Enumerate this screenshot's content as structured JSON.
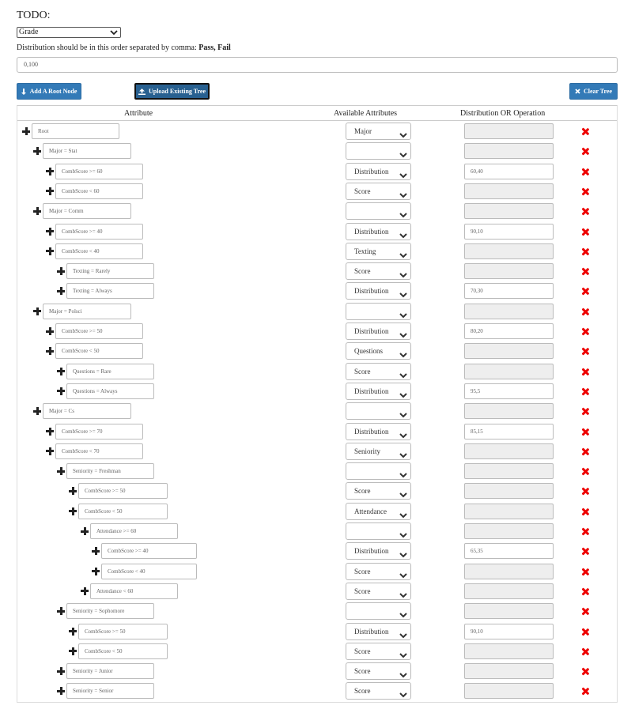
{
  "header": {
    "title": "TODO:",
    "target_value": "Grade",
    "hint_prefix": "Distribution should be in this order separated by comma:",
    "hint_classes": "Pass, Fail",
    "distribution_value": "0,100"
  },
  "buttons": {
    "add_root": "Add A Root Node",
    "upload": "Upload Existing Tree",
    "clear": "Clear Tree"
  },
  "table": {
    "headers": [
      "Attribute",
      "Available Attributes",
      "Distribution OR Operation"
    ],
    "rows": [
      {
        "label": "Root",
        "attribute": "Major",
        "distribution": ""
      },
      {
        "label": "Major = Stat",
        "attribute": "",
        "distribution": ""
      },
      {
        "label": "CombScore >= 60",
        "attribute": "Distribution",
        "distribution": "60,40"
      },
      {
        "label": "CombScore < 60",
        "attribute": "Score",
        "distribution": ""
      },
      {
        "label": "Major = Comm",
        "attribute": "",
        "distribution": ""
      },
      {
        "label": "CombScore >= 40",
        "attribute": "Distribution",
        "distribution": "90,10"
      },
      {
        "label": "CombScore < 40",
        "attribute": "Texting",
        "distribution": ""
      },
      {
        "label": "Texting = Rarely",
        "attribute": "Score",
        "distribution": ""
      },
      {
        "label": "Texting = Always",
        "attribute": "Distribution",
        "distribution": "70,30"
      },
      {
        "label": "Major = Polsci",
        "attribute": "",
        "distribution": ""
      },
      {
        "label": "CombScore >= 50",
        "attribute": "Distribution",
        "distribution": "80,20"
      },
      {
        "label": "CombScore < 50",
        "attribute": "Questions",
        "distribution": ""
      },
      {
        "label": "Questions = Rare",
        "attribute": "Score",
        "distribution": ""
      },
      {
        "label": "Questions = Always",
        "attribute": "Distribution",
        "distribution": "95,5"
      },
      {
        "label": "Major = Cs",
        "attribute": "",
        "distribution": ""
      },
      {
        "label": "CombScore >= 70",
        "attribute": "Distribution",
        "distribution": "85,15"
      },
      {
        "label": "CombScore < 70",
        "attribute": "Seniority",
        "distribution": ""
      },
      {
        "label": "Seniority = Freshman",
        "attribute": "",
        "distribution": ""
      },
      {
        "label": "CombScore >= 50",
        "attribute": "Score",
        "distribution": ""
      },
      {
        "label": "CombScore < 50",
        "attribute": "Attendance",
        "distribution": ""
      },
      {
        "label": "Attendance >= 60",
        "attribute": "",
        "distribution": ""
      },
      {
        "label": "CombScore >= 40",
        "attribute": "Distribution",
        "distribution": "65,35"
      },
      {
        "label": "CombScore < 40",
        "attribute": "Score",
        "distribution": ""
      },
      {
        "label": "Attendance < 60",
        "attribute": "Score",
        "distribution": ""
      },
      {
        "label": "Seniority = Sophomore",
        "attribute": "",
        "distribution": ""
      },
      {
        "label": "CombScore >= 50",
        "attribute": "Distribution",
        "distribution": "90,10"
      },
      {
        "label": "CombScore < 50",
        "attribute": "Score",
        "distribution": ""
      },
      {
        "label": "Seniority = Junior",
        "attribute": "Score",
        "distribution": ""
      },
      {
        "label": "Seniority = Senior",
        "attribute": "Score",
        "distribution": ""
      }
    ]
  },
  "colors": {
    "button_blue": "#337ab7",
    "delete_red": "#e00000",
    "disabled_gray": "#eeeeee"
  },
  "icons": [
    "plus-icon",
    "chevron-down-icon",
    "upload-icon",
    "close-icon",
    "delete-icon"
  ]
}
